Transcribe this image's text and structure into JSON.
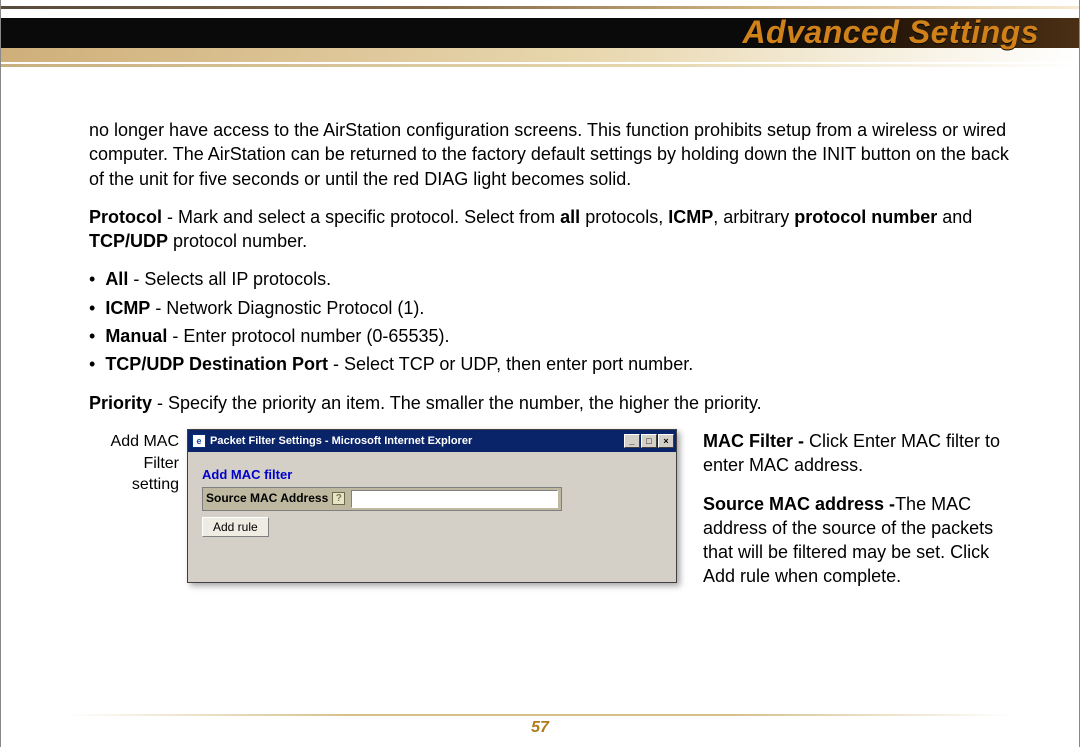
{
  "page_title": "Advanced Settings",
  "page_number": "57",
  "body": {
    "intro": "no longer have access to the AirStation configuration screens.  This function prohibits setup from a wireless or wired computer.  The AirStation can be returned to the factory default settings by holding down the INIT button on the back of the unit for five seconds or until the red DIAG light becomes solid.",
    "protocol_lead_b": "Protocol",
    "protocol_text_1": "  - Mark and select a specific protocol.  Select from ",
    "protocol_b_all": "all",
    "protocol_text_2": " protocols, ",
    "protocol_b_icmp": "ICMP",
    "protocol_text_3": ", arbitrary ",
    "protocol_b_pn": "protocol number",
    "protocol_text_4": " and ",
    "protocol_b_tcpudp": "TCP/UDP",
    "protocol_text_5": " protocol number.",
    "bullets": [
      {
        "b": "All",
        "rest": " - Selects all IP protocols."
      },
      {
        "b": "ICMP",
        "rest": " - Network Diagnostic Protocol (1)."
      },
      {
        "b": "Manual",
        "rest": " - Enter protocol number (0-65535)."
      },
      {
        "b": "TCP/UDP Destination Port",
        "rest": " - Select TCP or UDP, then enter port number."
      }
    ],
    "priority_b": "Priority",
    "priority_rest": " - Specify the priority  an item.  The smaller the number, the higher the priority."
  },
  "mac_section": {
    "caption_l1": "Add MAC",
    "caption_l2": "Filter",
    "caption_l3": "setting",
    "window_title": "Packet Filter Settings - Microsoft Internet Explorer",
    "panel_title": "Add MAC filter",
    "field_label": "Source MAC Address",
    "help_glyph": "?",
    "add_rule_label": "Add rule",
    "ie_icon_glyph": "e",
    "min_glyph": "_",
    "max_glyph": "□",
    "close_glyph": "×",
    "right": {
      "p1_b": "MAC Filter - ",
      "p1_rest": "Click Enter MAC filter to enter MAC address.",
      "p2_b": "Source MAC address -",
      "p2_rest": "The MAC address of the source of the packets that will be filtered may be set. Click Add rule when complete."
    }
  }
}
